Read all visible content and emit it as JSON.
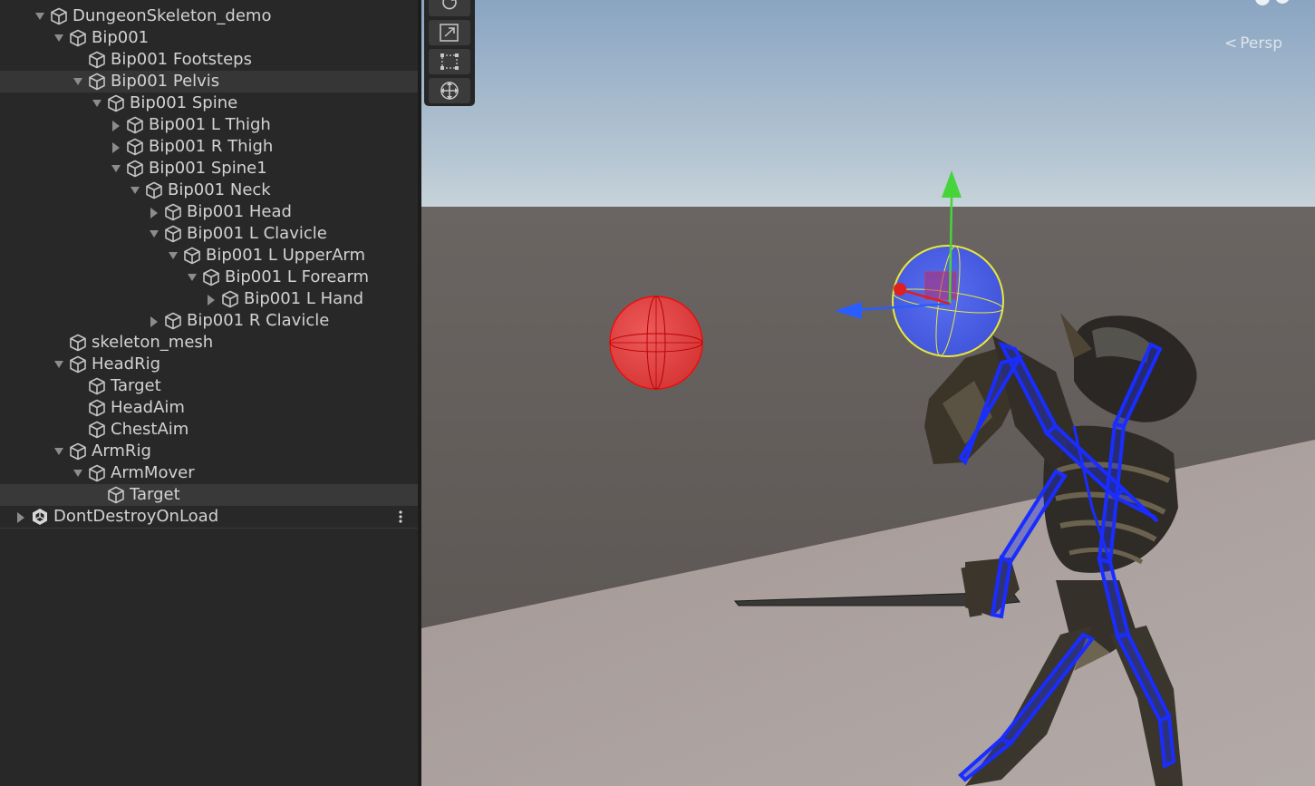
{
  "hierarchy": {
    "rows": [
      {
        "label": "DungeonSkeleton_demo",
        "arrow": "down",
        "depth": 0
      },
      {
        "label": "Bip001",
        "arrow": "down",
        "depth": 1
      },
      {
        "label": "Bip001 Footsteps",
        "arrow": "none",
        "depth": 2
      },
      {
        "label": "Bip001 Pelvis",
        "arrow": "down",
        "depth": 2,
        "highlight": true
      },
      {
        "label": "Bip001 Spine",
        "arrow": "down",
        "depth": 3
      },
      {
        "label": "Bip001 L Thigh",
        "arrow": "right",
        "depth": 4
      },
      {
        "label": "Bip001 R Thigh",
        "arrow": "right",
        "depth": 4
      },
      {
        "label": "Bip001 Spine1",
        "arrow": "down",
        "depth": 4
      },
      {
        "label": "Bip001 Neck",
        "arrow": "down",
        "depth": 5
      },
      {
        "label": "Bip001 Head",
        "arrow": "right",
        "depth": 6
      },
      {
        "label": "Bip001 L Clavicle",
        "arrow": "down",
        "depth": 6
      },
      {
        "label": "Bip001 L UpperArm",
        "arrow": "down",
        "depth": 7
      },
      {
        "label": "Bip001 L Forearm",
        "arrow": "down",
        "depth": 8
      },
      {
        "label": "Bip001 L Hand",
        "arrow": "right",
        "depth": 9
      },
      {
        "label": "Bip001 R Clavicle",
        "arrow": "right",
        "depth": 6
      },
      {
        "label": "skeleton_mesh",
        "arrow": "none",
        "depth": 1
      },
      {
        "label": "HeadRig",
        "arrow": "down",
        "depth": 1
      },
      {
        "label": "Target",
        "arrow": "none",
        "depth": 2
      },
      {
        "label": "HeadAim",
        "arrow": "none",
        "depth": 2
      },
      {
        "label": "ChestAim",
        "arrow": "none",
        "depth": 2
      },
      {
        "label": "ArmRig",
        "arrow": "down",
        "depth": 1
      },
      {
        "label": "ArmMover",
        "arrow": "down",
        "depth": 2
      },
      {
        "label": "Target",
        "arrow": "none",
        "depth": 3,
        "selected": true
      },
      {
        "label": "DontDestroyOnLoad",
        "arrow": "right",
        "depth": -1,
        "scene": true
      }
    ]
  },
  "sceneview": {
    "projection_label": "Persp",
    "tools": [
      "rotate-tool-icon",
      "scale-tool-icon",
      "rect-tool-icon",
      "transform-tool-icon"
    ],
    "colors": {
      "sky_top": "#8fa9c4",
      "sky_horizon": "#c8d4dc",
      "ground_far": "#5e5a57",
      "floor": "#a59b99",
      "target_sphere": "#e23a3a",
      "selected_sphere": "#4a5ce8",
      "bones": "#1a2dff",
      "axis_y": "#46d43a",
      "axis_x": "#e01f1f",
      "axis_z": "#2a5dff"
    }
  }
}
